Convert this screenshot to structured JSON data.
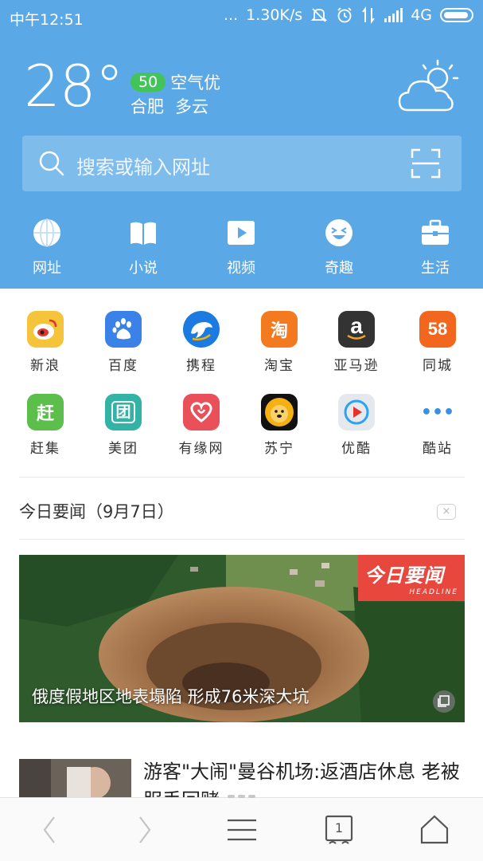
{
  "status_bar": {
    "time": "中午12:51",
    "dots": "...",
    "speed": "1.30K/s",
    "network": "4G"
  },
  "weather": {
    "temperature": "28°",
    "aqi_value": "50",
    "aqi_label": "空气优",
    "city": "合肥",
    "condition": "多云",
    "icon": "partly-cloudy-icon"
  },
  "search": {
    "placeholder": "搜索或输入网址"
  },
  "nav": [
    {
      "label": "网址",
      "icon": "globe-icon"
    },
    {
      "label": "小说",
      "icon": "book-icon"
    },
    {
      "label": "视频",
      "icon": "play-icon"
    },
    {
      "label": "奇趣",
      "icon": "laugh-icon"
    },
    {
      "label": "生活",
      "icon": "briefcase-icon"
    }
  ],
  "quick_links": [
    {
      "label": "新浪",
      "icon": "weibo-icon",
      "color": "#f5c43a",
      "glyph": "◉"
    },
    {
      "label": "百度",
      "icon": "baidu-icon",
      "color": "#3b82e8",
      "glyph": "du"
    },
    {
      "label": "携程",
      "icon": "ctrip-icon",
      "color": "#1c7be0",
      "glyph": "◐"
    },
    {
      "label": "淘宝",
      "icon": "taobao-icon",
      "color": "#f47a1f",
      "glyph": "淘"
    },
    {
      "label": "亚马逊",
      "icon": "amazon-icon",
      "color": "#333333",
      "glyph": "a"
    },
    {
      "label": "同城",
      "icon": "58-icon",
      "color": "#f2661e",
      "glyph": "58"
    },
    {
      "label": "赶集",
      "icon": "ganji-icon",
      "color": "#5cbf4b",
      "glyph": "赶"
    },
    {
      "label": "美团",
      "icon": "meituan-icon",
      "color": "#33b3a6",
      "glyph": "团"
    },
    {
      "label": "有缘网",
      "icon": "youyuan-icon",
      "color": "#e9505a",
      "glyph": "♡"
    },
    {
      "label": "苏宁",
      "icon": "suning-icon",
      "color": "#f5b014",
      "glyph": "◕"
    },
    {
      "label": "优酷",
      "icon": "youku-icon",
      "color": "#e5e9ee",
      "glyph": "▶"
    },
    {
      "label": "酷站",
      "icon": "more-icon",
      "color": "#ffffff",
      "glyph": "•••"
    }
  ],
  "news": {
    "section_title": "今日要闻（9月7日）",
    "close_glyph": "×",
    "hero_tag": "今日要闻",
    "hero_tag_sub": "HEADLINE",
    "hero_caption": "俄度假地区地表塌陷 形成76米深大坑",
    "item2_title": "游客\"大闹\"曼谷机场:返酒店休息 老被服丢回赌"
  },
  "bottom_bar": {
    "tab_count": "1"
  }
}
